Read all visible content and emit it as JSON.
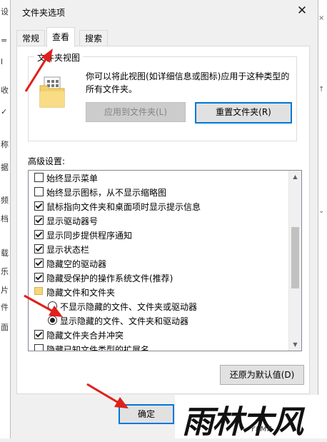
{
  "dialog": {
    "title": "文件夹选项",
    "close_glyph": "✕"
  },
  "tabs": [
    {
      "label": "常规",
      "active": false
    },
    {
      "label": "查看",
      "active": true
    },
    {
      "label": "搜索",
      "active": false
    }
  ],
  "folder_view": {
    "group_title": "文件夹视图",
    "description": "你可以将此视图(如详细信息或图标)应用于这种类型的所有文件夹。",
    "apply_button": "应用到文件夹(L)",
    "reset_button": "重置文件夹(R)"
  },
  "advanced": {
    "label": "高级设置:",
    "items": [
      {
        "type": "checkbox",
        "checked": false,
        "label": "始终显示菜单"
      },
      {
        "type": "checkbox",
        "checked": false,
        "label": "始终显示图标，从不显示缩略图"
      },
      {
        "type": "checkbox",
        "checked": true,
        "label": "鼠标指向文件夹和桌面项时显示提示信息"
      },
      {
        "type": "checkbox",
        "checked": true,
        "label": "显示驱动器号"
      },
      {
        "type": "checkbox",
        "checked": true,
        "label": "显示同步提供程序通知"
      },
      {
        "type": "checkbox",
        "checked": true,
        "label": "显示状态栏"
      },
      {
        "type": "checkbox",
        "checked": true,
        "label": "隐藏空的驱动器"
      },
      {
        "type": "checkbox",
        "checked": true,
        "label": "隐藏受保护的操作系统文件(推荐)"
      },
      {
        "type": "folder",
        "label": "隐藏文件和文件夹"
      },
      {
        "type": "radio",
        "checked": false,
        "label": "不显示隐藏的文件、文件夹或驱动器"
      },
      {
        "type": "radio",
        "checked": true,
        "label": "显示隐藏的文件、文件夹和驱动器"
      },
      {
        "type": "checkbox",
        "checked": true,
        "label": "隐藏文件夹合并冲突"
      },
      {
        "type": "checkbox",
        "checked": false,
        "label": "隐藏已知文件类型的扩展名"
      }
    ],
    "scroll_up_glyph": "▲",
    "scroll_down_glyph": "▼"
  },
  "buttons": {
    "restore_defaults": "还原为默认值(D)",
    "ok": "确定"
  },
  "background_window": {
    "left_chars": [
      "设",
      "=",
      "l",
      "收",
      "✓",
      "称",
      "据",
      "频",
      "档",
      "载",
      "乐",
      "片",
      "件",
      "面"
    ],
    "right_chars": [
      "×",
      "↑",
      "⌄"
    ]
  },
  "watermark": {
    "main_text": "雨林木风",
    "sub_text": "YLMF"
  },
  "colors": {
    "accent": "#0078d7",
    "arrow": "#e0201b",
    "panel": "#ffffff",
    "dialog_bg": "#f0f0f0"
  }
}
